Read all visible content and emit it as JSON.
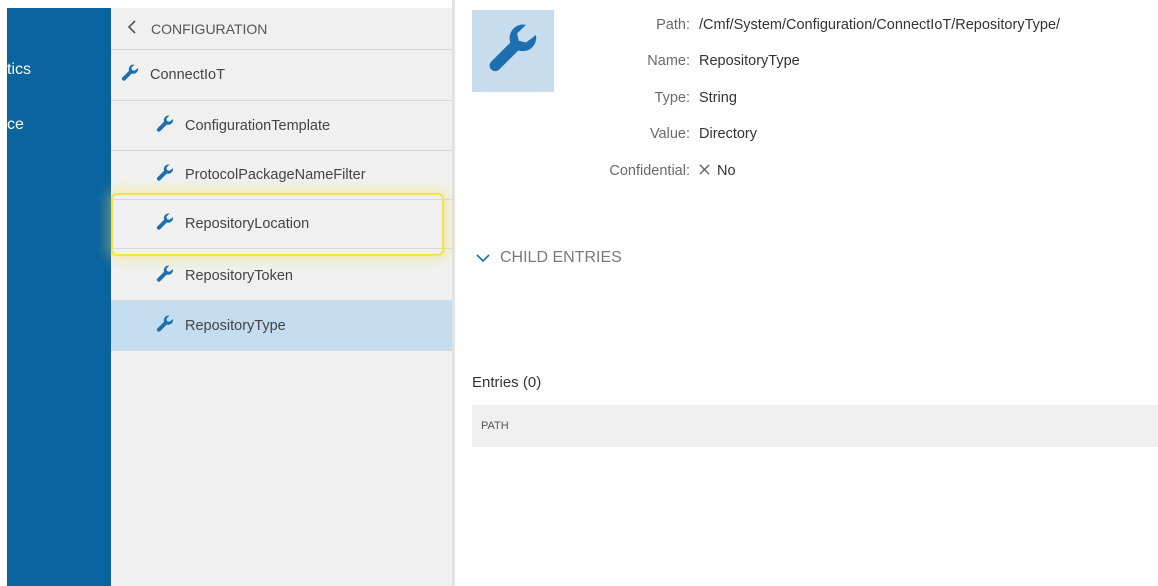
{
  "nav": {
    "items": [
      "tics",
      "ce"
    ]
  },
  "tree": {
    "header": "CONFIGURATION",
    "root": "ConnectIoT",
    "children": [
      "ConfigurationTemplate",
      "ProtocolPackageNameFilter",
      "RepositoryLocation",
      "RepositoryToken",
      "RepositoryType"
    ],
    "selected": "RepositoryType",
    "highlighted": "RepositoryLocation"
  },
  "details": {
    "path_label": "Path:",
    "path_value": "/Cmf/System/Configuration/ConnectIoT/RepositoryType/",
    "name_label": "Name:",
    "name_value": "RepositoryType",
    "type_label": "Type:",
    "type_value": "String",
    "value_label": "Value:",
    "value_value": "Directory",
    "confidential_label": "Confidential:",
    "confidential_value": "No"
  },
  "child_entries": {
    "toggle_label": "CHILD ENTRIES",
    "entries_title": "Entries (0)",
    "column_path": "PATH"
  },
  "colors": {
    "nav_bg": "#0b64a0",
    "icon_blue": "#1d6fb0",
    "selected_row": "#c4dcef",
    "highlight": "#f2e34a"
  },
  "icons": [
    "wrench-icon",
    "chevron-left-icon",
    "chevron-down-icon",
    "close-icon"
  ]
}
